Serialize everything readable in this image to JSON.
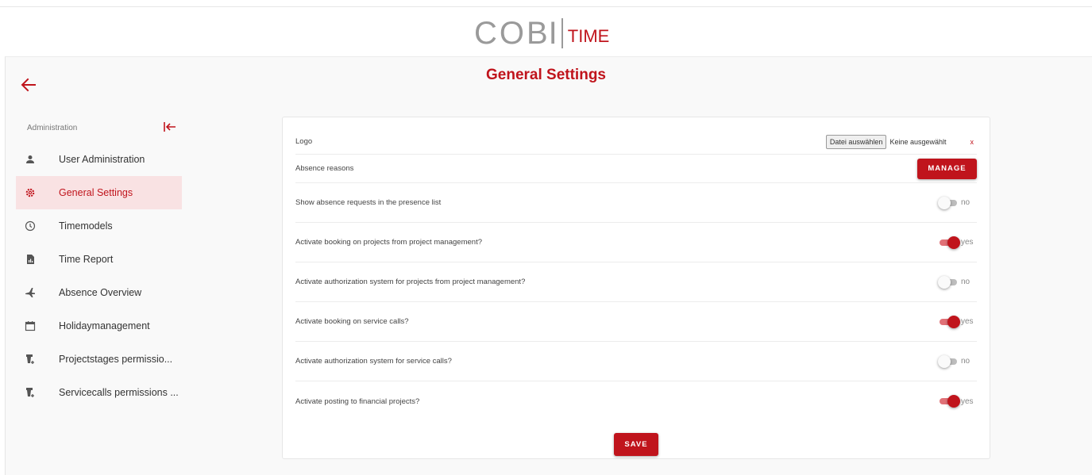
{
  "brand": {
    "name_part1": "CO",
    "name_part2": "BI",
    "name_part3": "TIME",
    "accent": "#c0141c"
  },
  "page": {
    "title": "General Settings"
  },
  "icons": {
    "back": "arrow-left-icon",
    "collapse": "collapse-left-icon"
  },
  "sidebar": {
    "heading": "Administration",
    "items": [
      {
        "label": "User Administration",
        "icon": "person-icon",
        "active": false
      },
      {
        "label": "General Settings",
        "icon": "gear-icon",
        "active": true
      },
      {
        "label": "Timemodels",
        "icon": "clock-icon",
        "active": false
      },
      {
        "label": "Time Report",
        "icon": "report-icon",
        "active": false
      },
      {
        "label": "Absence Overview",
        "icon": "airplane-icon",
        "active": false
      },
      {
        "label": "Holidaymanagement",
        "icon": "calendar-icon",
        "active": false
      },
      {
        "label": "Projectstages permissio...",
        "icon": "permission-icon",
        "active": false
      },
      {
        "label": "Servicecalls permissions ...",
        "icon": "permission-icon",
        "active": false
      }
    ]
  },
  "settings": {
    "logo": {
      "label": "Logo",
      "choose_file": "Datei auswählen",
      "no_file": "Keine ausgewählt",
      "clear": "x"
    },
    "absence_reasons": {
      "label": "Absence reasons",
      "button": "MANAGE"
    },
    "toggles": [
      {
        "label": "Show absence requests in the presence list",
        "on": false,
        "value_text": "no"
      },
      {
        "label": "Activate booking on projects from project management?",
        "on": true,
        "value_text": "yes"
      },
      {
        "label": "Activate authorization system for projects from project management?",
        "on": false,
        "value_text": "no"
      },
      {
        "label": "Activate booking on service calls?",
        "on": true,
        "value_text": "yes"
      },
      {
        "label": "Activate authorization system for service calls?",
        "on": false,
        "value_text": "no"
      },
      {
        "label": "Activate posting to financial projects?",
        "on": true,
        "value_text": "yes"
      }
    ],
    "save_label": "SAVE"
  }
}
